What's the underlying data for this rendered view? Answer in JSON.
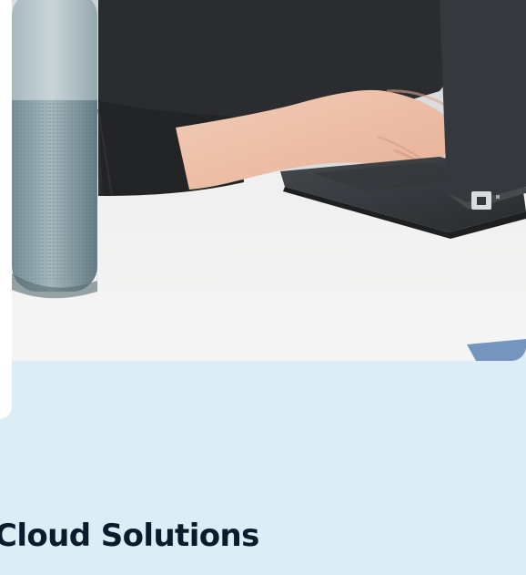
{
  "section": {
    "title": "Cloud Solutions"
  },
  "hero": {
    "image": "person-typing-on-laptop"
  },
  "colors": {
    "background": "#dcedf8",
    "card": "#ffffff",
    "title": "#0b1b2e"
  }
}
